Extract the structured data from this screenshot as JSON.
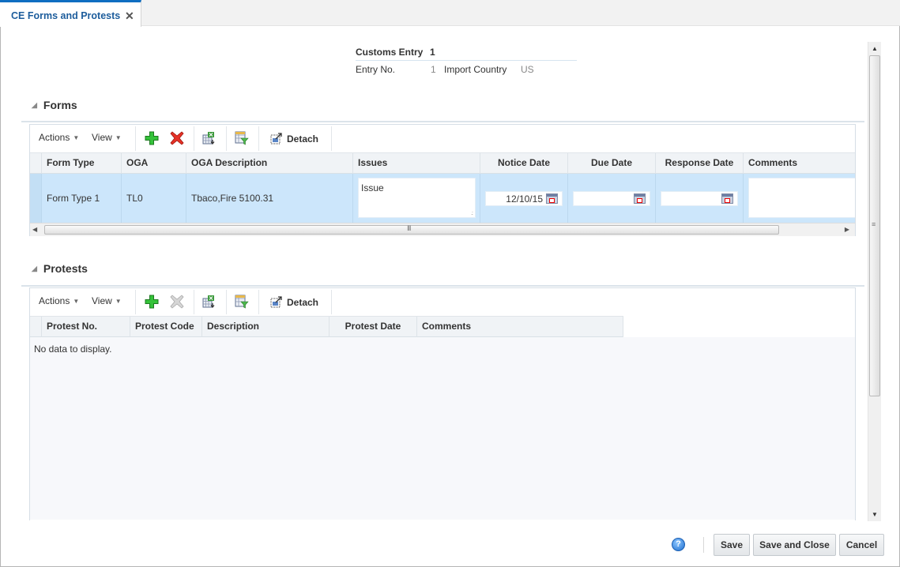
{
  "tab": {
    "label": "CE Forms and Protests",
    "close_icon": "close-icon"
  },
  "header": {
    "title_label": "Customs Entry",
    "title_value": "1",
    "entry_no_label": "Entry No.",
    "entry_no_value": "1",
    "import_country_label": "Import Country",
    "import_country_value": "US"
  },
  "forms": {
    "section_title": "Forms",
    "toolbar": {
      "actions_label": "Actions",
      "view_label": "View",
      "add_icon": "add-icon",
      "delete_icon": "delete-icon",
      "export_icon": "export-to-excel-icon",
      "filter_icon": "query-by-example-icon",
      "detach_label": "Detach"
    },
    "columns": [
      "Form Type",
      "OGA",
      "OGA Description",
      "Issues",
      "Notice Date",
      "Due Date",
      "Response Date",
      "Comments"
    ],
    "rows": [
      {
        "form_type": "Form Type 1",
        "oga": "TL0",
        "oga_description": "Tbaco,Fire 5100.31",
        "issues": "Issue",
        "notice_date": "12/10/15",
        "due_date": "",
        "response_date": "",
        "comments": ""
      }
    ]
  },
  "protests": {
    "section_title": "Protests",
    "toolbar": {
      "actions_label": "Actions",
      "view_label": "View",
      "add_icon": "add-icon",
      "delete_icon": "delete-icon-disabled",
      "export_icon": "export-to-excel-icon",
      "filter_icon": "query-by-example-icon",
      "detach_label": "Detach"
    },
    "columns": [
      "Protest No.",
      "Protest Code",
      "Description",
      "Protest Date",
      "Comments"
    ],
    "empty_message": "No data to display."
  },
  "footer": {
    "help_icon": "help-icon",
    "save_label": "Save",
    "save_close_label": "Save and Close",
    "cancel_label": "Cancel"
  },
  "colors": {
    "accent": "#0f6ec1",
    "selected_row": "#cce6fb",
    "delete_red": "#e02020",
    "add_green": "#2fb52f"
  }
}
